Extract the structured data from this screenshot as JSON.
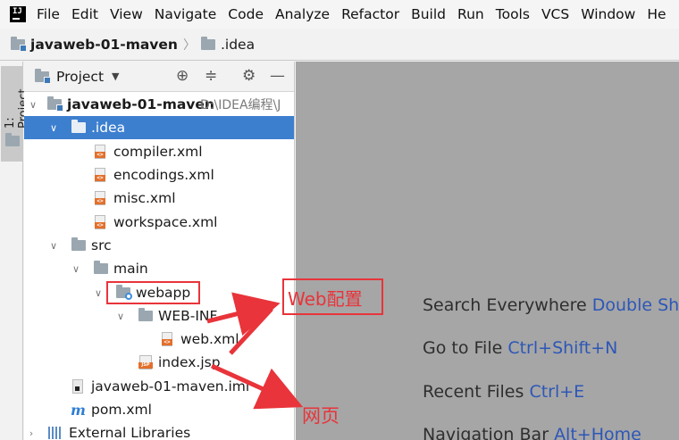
{
  "menubar": {
    "items": [
      "File",
      "Edit",
      "View",
      "Navigate",
      "Code",
      "Analyze",
      "Refactor",
      "Build",
      "Run",
      "Tools",
      "VCS",
      "Window",
      "He"
    ]
  },
  "breadcrumb": {
    "project": "javaweb-01-maven",
    "folder": ".idea"
  },
  "left_strip": {
    "tab_label": "1: Project"
  },
  "project_panel": {
    "title": "Project",
    "dropdown_glyph": "▼",
    "tree": {
      "root_name": "javaweb-01-maven",
      "root_path": "D:\\IDEA编程\\J",
      "idea": ".idea",
      "compiler": "compiler.xml",
      "encodings": "encodings.xml",
      "misc": "misc.xml",
      "workspace": "workspace.xml",
      "src": "src",
      "main": "main",
      "webapp": "webapp",
      "webinf": "WEB-INF",
      "webxml": "web.xml",
      "indexjsp": "index.jsp",
      "iml": "javaweb-01-maven.iml",
      "pom": "pom.xml",
      "libs": "External Libraries"
    }
  },
  "editor": {
    "hints": [
      {
        "label": "Search Everywhere",
        "key": "Double Shi"
      },
      {
        "label": "Go to File",
        "key": "Ctrl+Shift+N"
      },
      {
        "label": "Recent Files",
        "key": "Ctrl+E"
      },
      {
        "label": "Navigation Bar",
        "key": "Alt+Home"
      }
    ]
  },
  "annotations": {
    "web_config": "Web配置",
    "web_page": "网页",
    "color": "#e8343a"
  },
  "colors": {
    "selection": "#3d7fcf",
    "hint_key": "#2d57b7",
    "editor_bg": "#a6a6a6"
  }
}
